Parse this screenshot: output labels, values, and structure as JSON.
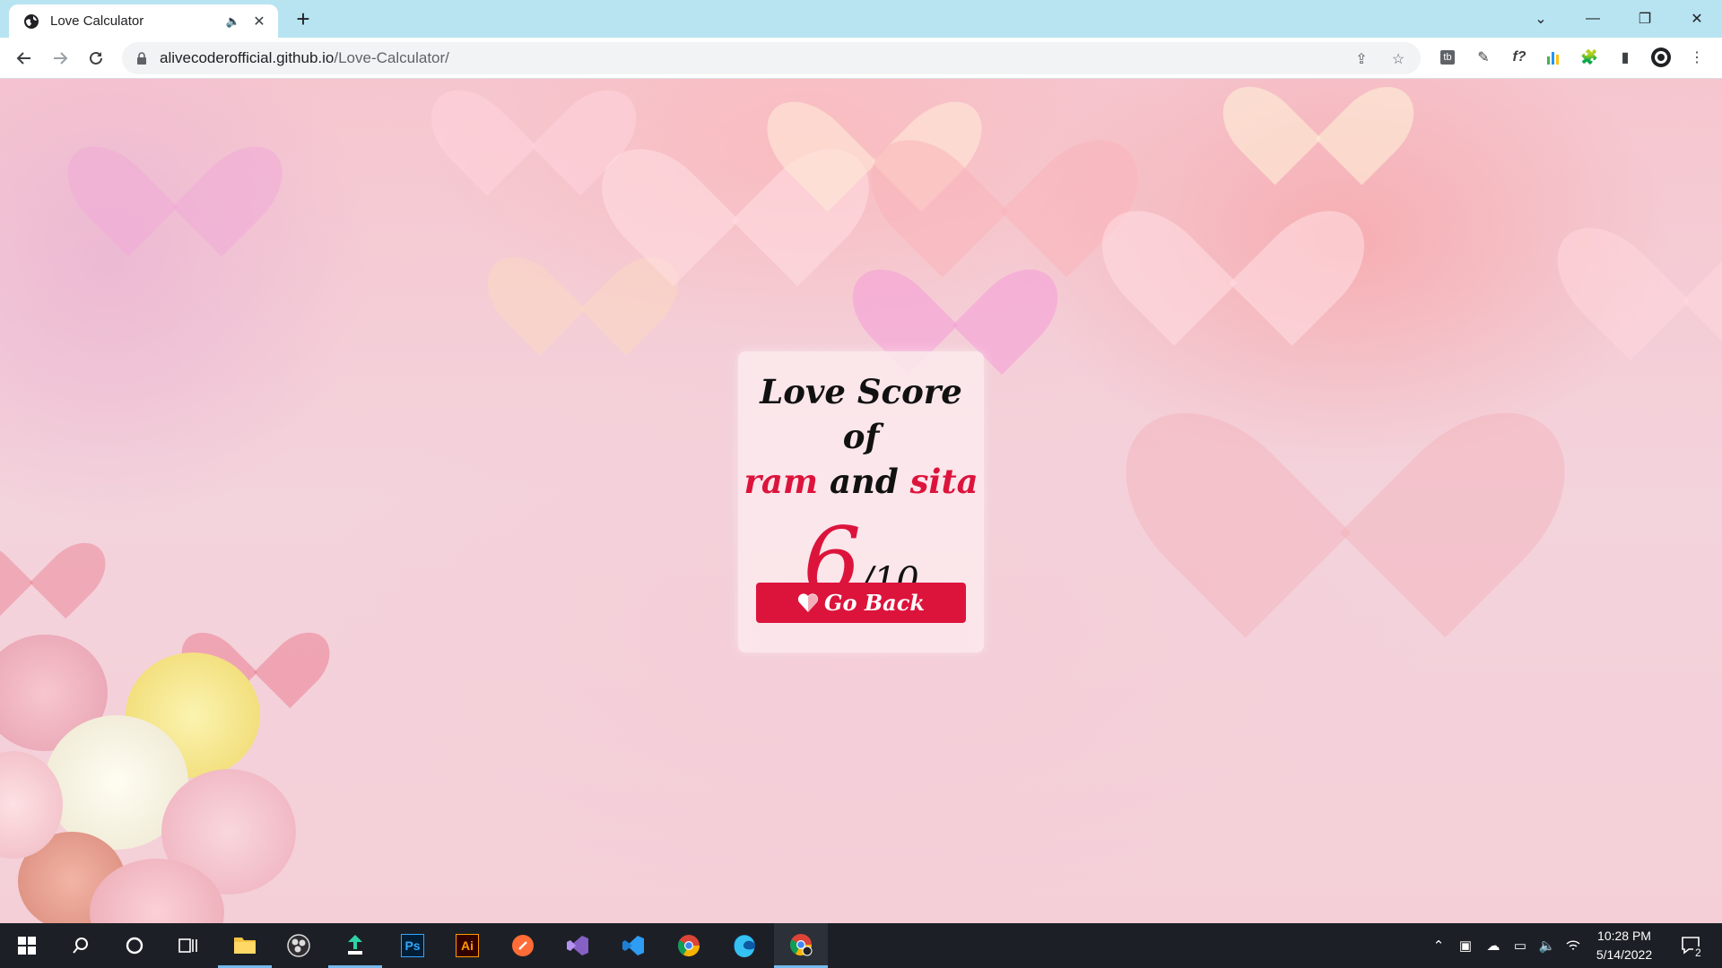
{
  "browser": {
    "tab": {
      "title": "Love Calculator"
    },
    "url": {
      "host": "alivecoderofficial.github.io",
      "path": "/Love-Calculator/"
    }
  },
  "card": {
    "title_line1": "Love Score of",
    "name1": "ram",
    "and": "and",
    "name2": "sita",
    "score": "6",
    "out_of": "/10",
    "button_label": "Go Back"
  },
  "colors": {
    "accent": "#dc143c",
    "tabstrip": "#b8e4f2",
    "taskbar": "#1c2026"
  },
  "taskbar": {
    "apps": [
      "start-icon",
      "search-icon",
      "cortana-icon",
      "task-view-icon",
      "file-explorer-icon",
      "obs-icon",
      "app-icon",
      "photoshop-icon",
      "illustrator-icon",
      "postman-icon",
      "visual-studio-icon",
      "vscode-icon",
      "chrome-icon",
      "edge-icon",
      "chrome-profile-icon"
    ],
    "photoshop_label": "Ps",
    "illustrator_label": "Ai",
    "time": "10:28 PM",
    "date": "5/14/2022",
    "notification_count": "2"
  }
}
